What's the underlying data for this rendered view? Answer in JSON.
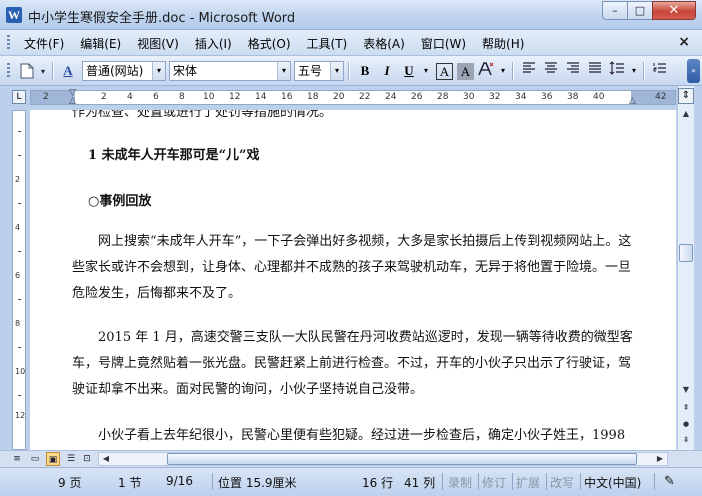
{
  "window": {
    "title": "中小学生寒假安全手册.doc - Microsoft Word",
    "app_icon_letter": "W",
    "minimize_glyph": "–",
    "maximize_glyph": "□",
    "close_glyph": "✕"
  },
  "menu": {
    "items": [
      "文件(F)",
      "编辑(E)",
      "视图(V)",
      "插入(I)",
      "格式(O)",
      "工具(T)",
      "表格(A)",
      "窗口(W)",
      "帮助(H)"
    ],
    "close_doc_glyph": "×"
  },
  "toolbar": {
    "style_icon_label": "A",
    "style_value": "普通(网站)",
    "font_value": "宋体",
    "size_value": "五号",
    "bold_label": "B",
    "italic_label": "I",
    "underline_label": "U",
    "border_label": "A",
    "shade_label": "A",
    "dropdown_glyph": "▾",
    "more_glyph": "»"
  },
  "ruler": {
    "tab_selector": "L",
    "numbers": [
      "2",
      "2",
      "4",
      "6",
      "8",
      "10",
      "12",
      "14",
      "16",
      "18",
      "20",
      "22",
      "24",
      "26",
      "28",
      "30",
      "32",
      "34",
      "36",
      "38",
      "40",
      "42"
    ],
    "vertical_numbers": [
      "2",
      "4",
      "6",
      "8",
      "10",
      "12"
    ]
  },
  "document": {
    "cut_line": "作为检查、处置或进行了处罚等措施的情况。",
    "heading_1": "1 未成年人开车那可是“儿”戏",
    "heading_2": "○事例回放",
    "para_1": "网上搜索“未成年人开车”，一下子会弹出好多视频，大多是家长拍摄后上传到视频网站上。这些家长或许不会想到，让身体、心理都并不成熟的孩子来驾驶机动车，无异于将他置于险境。一旦危险发生，后悔都来不及了。",
    "para_2": "2015 年 1 月，高速交警三支队一大队民警在丹河收费站巡逻时，发现一辆等待收费的微型客车，号牌上竟然贴着一张光盘。民警赶紧上前进行检查。不过，开车的小伙子只出示了行驶证，驾驶证却拿不出来。面对民警的询问，小伙子坚持说自己没带。",
    "para_3": "小伙子看上去年纪很小，民警心里便有些犯疑。经过进一步检查后，确定小伙子姓王，1998"
  },
  "scrollbar": {
    "up_glyph": "▲",
    "down_glyph": "▼",
    "split_glyph": "⇕",
    "prev_page_glyph": "⇞",
    "select_browse_glyph": "●",
    "next_page_glyph": "⇟",
    "left_glyph": "◀",
    "right_glyph": "▶"
  },
  "views": {
    "normal": "≡",
    "web": "▭",
    "print": "▣",
    "outline": "☰",
    "reading": "⊡"
  },
  "status": {
    "page": "9 页",
    "section": "1 节",
    "page_of": "9/16",
    "position": "位置 15.9厘米",
    "line": "16 行",
    "column": "41 列",
    "rec": "录制",
    "trk": "修订",
    "ext": "扩展",
    "ovr": "改写",
    "language": "中文(中国)",
    "spell_icon": "✎"
  }
}
